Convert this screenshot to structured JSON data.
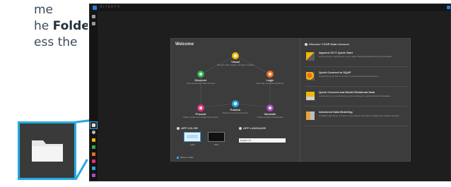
{
  "instructions": {
    "line1": "me",
    "line2_prefix": "he ",
    "line2_bold": "Folder",
    "line3": "ess the"
  },
  "app": {
    "title": "ALTERYX",
    "welcome_title": "Welcome",
    "nodes": [
      {
        "id": "visual",
        "label": "Visual",
        "desc": "Prepare data, deploy, visualize insights",
        "color": "#f2b705"
      },
      {
        "id": "discover",
        "label": "Discover",
        "desc": "Find and access data sources",
        "color": "#2bb24c"
      },
      {
        "id": "logic",
        "label": "Logic",
        "desc": "Add logic and build workflows",
        "color": "#f26c1f"
      },
      {
        "id": "present",
        "label": "Present",
        "desc": "Share results and insights with others",
        "color": "#e5317b"
      },
      {
        "id": "publish",
        "label": "Publish",
        "desc": "Publish to server and share",
        "color": "#27a9e1"
      },
      {
        "id": "illustrate",
        "label": "Illustrate",
        "desc": "Create visuals and illustrate",
        "color": "#a54bc1"
      }
    ],
    "app_color_label": "APP COLOR",
    "app_language_label": "APP LANGUAGE",
    "theme_light": "Light",
    "theme_dark": "Dark",
    "language_value": "English US",
    "show_on_start": "Show on start",
    "resources_head": "Discover YOUR Data resource",
    "resources": [
      {
        "title": "Append JS IT Quick Start",
        "desc": "A look at how to add layers to your data modeling dashboard and presentation.",
        "icon_color": "#f2b705"
      },
      {
        "title": "Quick Connect to SQAP",
        "desc": "A quick demo on how to connect to Microsoft Analysis Services.",
        "icon_color": "#f26c1f"
      },
      {
        "title": "Quick Connect and Model Relational Data",
        "desc": "A quick demo on connecting to and modeling an existing relational database.",
        "icon_color": "#f2b705"
      },
      {
        "title": "Advanced Data Modeling",
        "desc": "A walkthrough demo on how to use analytics and data modeling with multiple settings.",
        "icon_color": "#e8a33d"
      }
    ]
  },
  "leftbar": {
    "icons": [
      {
        "name": "home-icon",
        "color": "#9a9a9a"
      },
      {
        "name": "new-file-icon",
        "color": "#9a9a9a"
      },
      {
        "name": "folder-icon",
        "color": "#e0e0e0"
      },
      {
        "name": "gear-icon",
        "color": "#bdbdbd"
      },
      {
        "name": "visual-app-icon",
        "color": "#f2b705"
      },
      {
        "name": "discover-app-icon",
        "color": "#2bb24c"
      },
      {
        "name": "logic-app-icon",
        "color": "#f26c1f"
      },
      {
        "name": "present-app-icon",
        "color": "#e5317b"
      },
      {
        "name": "publish-app-icon",
        "color": "#27a9e1"
      },
      {
        "name": "illustrate-app-icon",
        "color": "#a54bc1"
      }
    ]
  },
  "colors": {
    "accent": "#27a9e1"
  }
}
